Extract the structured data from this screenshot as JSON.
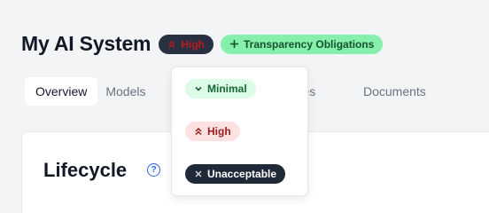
{
  "header": {
    "title": "My AI System",
    "risk_badge": "High",
    "transparency_badge": "Transparency Obligations"
  },
  "tabs": [
    {
      "label": "Overview"
    },
    {
      "label": "Models"
    },
    {
      "label": "urces"
    },
    {
      "label": "Documents"
    }
  ],
  "risk_menu": {
    "options": [
      {
        "label": "Minimal",
        "icon": "chevron-down-icon"
      },
      {
        "label": "High",
        "icon": "double-chevron-up-icon"
      },
      {
        "label": "Unacceptable",
        "icon": "close-icon"
      }
    ]
  },
  "section": {
    "title": "Lifecycle",
    "help": "?"
  },
  "colors": {
    "minimal_bg": "#dcfce7",
    "high_bg": "#fee2e2",
    "unacceptable_bg": "#1f2937",
    "transparency_bg": "#86efac",
    "accent": "#2563eb"
  }
}
